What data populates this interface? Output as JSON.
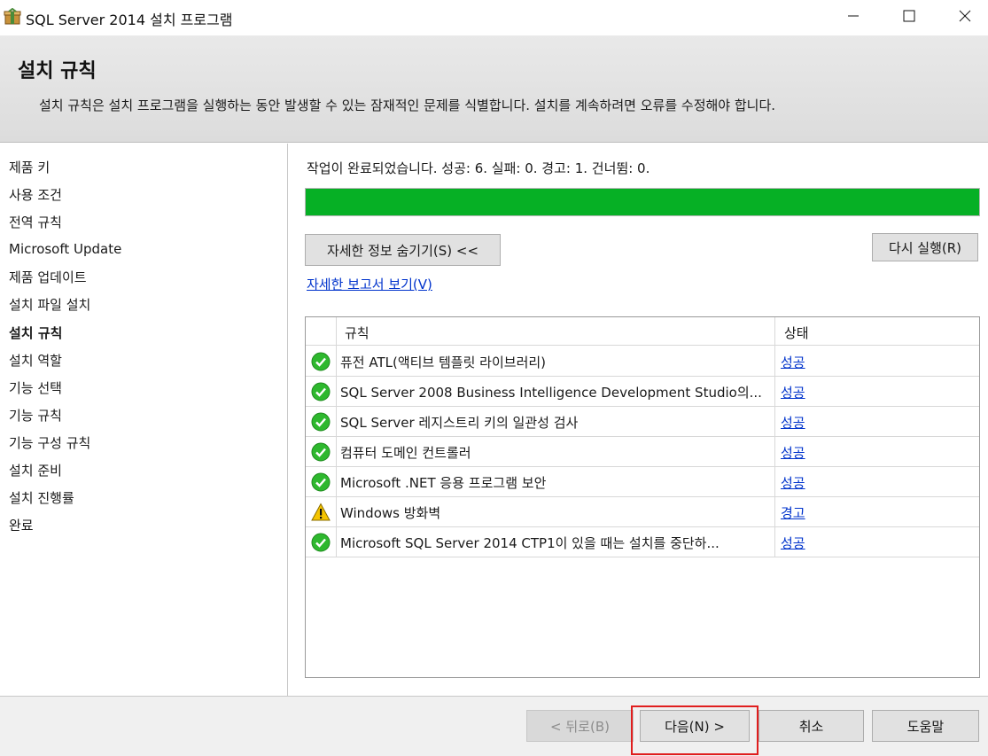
{
  "window": {
    "title": "SQL Server 2014 설치 프로그램"
  },
  "header": {
    "title": "설치 규칙",
    "description": "설치 규칙은 설치 프로그램을 실행하는 동안 발생할 수 있는 잠재적인 문제를 식별합니다. 설치를 계속하려면 오류를 수정해야 합니다."
  },
  "sidebar": {
    "items": [
      {
        "label": "제품 키"
      },
      {
        "label": "사용 조건"
      },
      {
        "label": "전역 규칙"
      },
      {
        "label": "Microsoft Update"
      },
      {
        "label": "제품 업데이트"
      },
      {
        "label": "설치 파일 설치"
      },
      {
        "label": "설치 규칙",
        "active": true
      },
      {
        "label": "설치 역할"
      },
      {
        "label": "기능 선택"
      },
      {
        "label": "기능 규칙"
      },
      {
        "label": "기능 구성 규칙"
      },
      {
        "label": "설치 준비"
      },
      {
        "label": "설치 진행률"
      },
      {
        "label": "완료"
      }
    ]
  },
  "main": {
    "status_text": "작업이 완료되었습니다. 성공: 6. 실패: 0. 경고: 1. 건너뜀: 0.",
    "progress_fraction": 1.0,
    "progress_color": "#06b025",
    "hide_details_label": "자세한 정보 숨기기(S) <<",
    "rerun_label": "다시 실행(R)",
    "view_report_label": "자세한 보고서 보기(V)"
  },
  "rules_table": {
    "columns": [
      "규칙",
      "상태"
    ],
    "rows": [
      {
        "icon": "success-check-icon",
        "rule": "퓨전 ATL(액티브 템플릿 라이브러리)",
        "status": "성공"
      },
      {
        "icon": "success-check-icon",
        "rule": "SQL Server 2008 Business Intelligence Development Studio의...",
        "status": "성공"
      },
      {
        "icon": "success-check-icon",
        "rule": "SQL Server 레지스트리 키의 일관성 검사",
        "status": "성공"
      },
      {
        "icon": "success-check-icon",
        "rule": "컴퓨터 도메인 컨트롤러",
        "status": "성공"
      },
      {
        "icon": "success-check-icon",
        "rule": "Microsoft .NET 응용 프로그램 보안",
        "status": "성공"
      },
      {
        "icon": "warning-icon",
        "rule": "Windows 방화벽",
        "status": "경고"
      },
      {
        "icon": "success-check-icon",
        "rule": "Microsoft SQL Server 2014 CTP1이 있을 때는 설치를 중단하...",
        "status": "성공"
      }
    ]
  },
  "footer": {
    "back_label": "< 뒤로(B)",
    "next_label": "다음(N) >",
    "cancel_label": "취소",
    "help_label": "도움말"
  },
  "colors": {
    "success": "#2eb82e",
    "warning": "#f5c400",
    "link": "#0033cc",
    "highlight": "#e01e1e"
  }
}
